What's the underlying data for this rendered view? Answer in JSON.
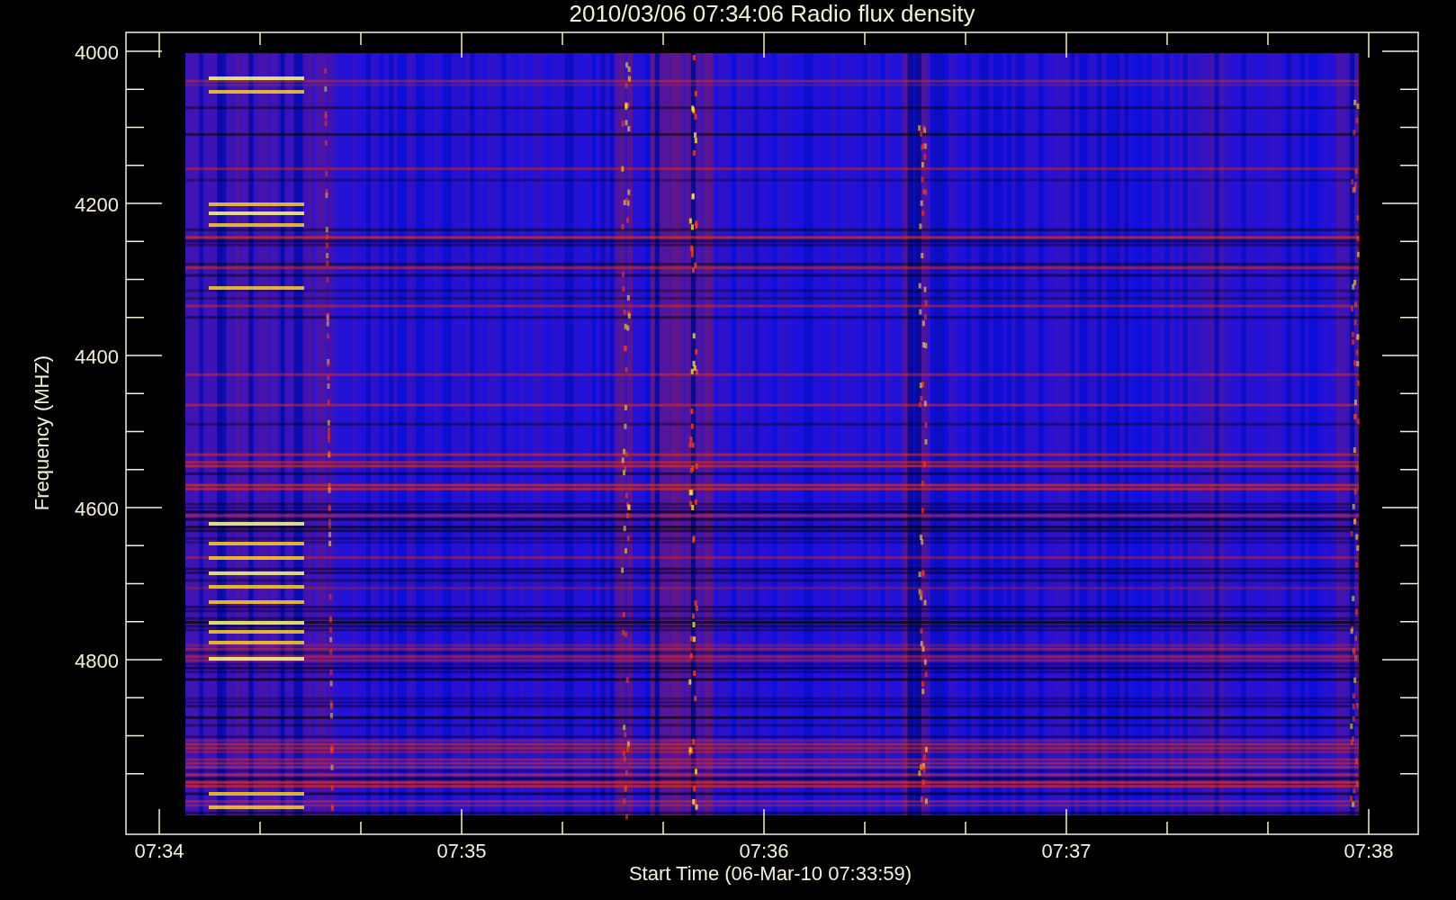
{
  "plot": {
    "title": "2010/03/06 07:34:06 Radio flux density",
    "y_axis": {
      "label": "Frequency (MHZ)",
      "ticks": [
        "4000",
        "4200",
        "4400",
        "4600",
        "4800"
      ]
    },
    "x_axis": {
      "label": "Start Time (06-Mar-10 07:33:59)",
      "ticks": [
        "07:34",
        "07:35",
        "07:36",
        "07:37",
        "07:38"
      ]
    }
  }
}
